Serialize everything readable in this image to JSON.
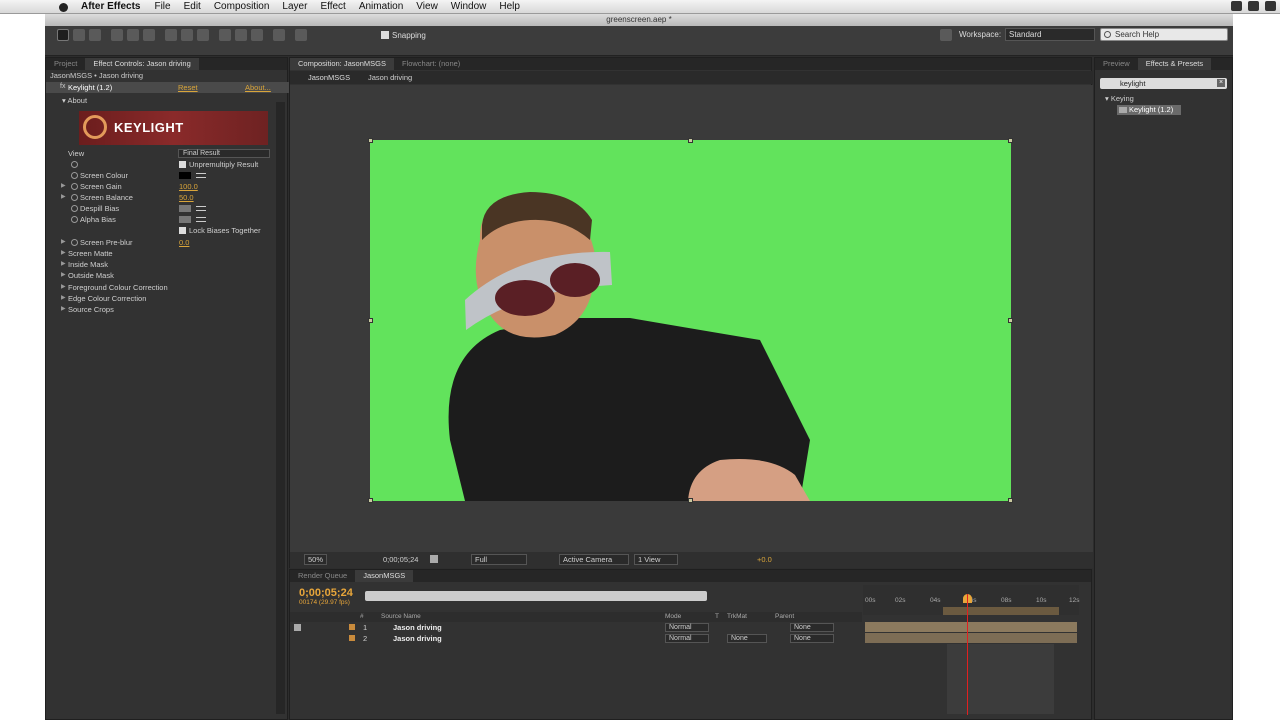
{
  "menubar": {
    "app_name": "After Effects",
    "items": [
      "File",
      "Edit",
      "Composition",
      "Layer",
      "Effect",
      "Animation",
      "View",
      "Window",
      "Help"
    ]
  },
  "window": {
    "title": "greenscreen.aep *"
  },
  "toolbar": {
    "snapping_label": "Snapping",
    "workspace_label": "Workspace:",
    "workspace_value": "Standard",
    "search_placeholder": "Search Help"
  },
  "left_panel": {
    "tabs": [
      "Project",
      "Effect Controls: Jason driving"
    ],
    "title": "JasonMSGS • Jason driving",
    "effect": {
      "name": "Keylight (1.2)",
      "fx": "fx",
      "reset": "Reset",
      "about": "About..."
    },
    "about_label": "About",
    "logo_text": "KEYLIGHT",
    "view_label": "View",
    "view_value": "Final Result",
    "unpremultiply": "Unpremultiply Result",
    "screen_colour": "Screen Colour",
    "screen_gain": "Screen Gain",
    "screen_gain_value": "100.0",
    "screen_balance": "Screen Balance",
    "screen_balance_value": "50.0",
    "despill_bias": "Despill Bias",
    "alpha_bias": "Alpha Bias",
    "lock_biases": "Lock Biases Together",
    "screen_preblur": "Screen Pre-blur",
    "screen_preblur_value": "0.0",
    "groups": [
      "Screen Matte",
      "Inside Mask",
      "Outside Mask",
      "Foreground Colour Correction",
      "Edge Colour Correction",
      "Source Crops"
    ]
  },
  "comp_panel": {
    "tabs": [
      "Composition: JasonMSGS",
      "Flowchart: (none)"
    ],
    "crumbs": [
      "JasonMSGS",
      "Jason driving"
    ],
    "bottom": {
      "zoom": "50%",
      "timecode": "0;00;05;24",
      "resolution": "Full",
      "camera": "Active Camera",
      "views": "1 View",
      "exposure": "+0.0"
    }
  },
  "right_panel": {
    "tabs": [
      "Preview",
      "Effects & Presets"
    ],
    "search_value": "keylight",
    "category": "Keying",
    "item": "Keylight (1.2)"
  },
  "timeline": {
    "tabs": [
      "Render Queue",
      "JasonMSGS"
    ],
    "timecode": "0;00;05;24",
    "fps": "00174 (29.97 fps)",
    "columns": [
      "#",
      "Source Name",
      "Mode",
      "T",
      "TrkMat",
      "Parent"
    ],
    "layers": [
      {
        "num": "1",
        "name": "Jason driving",
        "mode": "Normal",
        "trkmat": "",
        "parent": "None"
      },
      {
        "num": "2",
        "name": "Jason driving",
        "mode": "Normal",
        "trkmat": "None",
        "parent": "None"
      }
    ],
    "ruler": [
      "00s",
      "02s",
      "04s",
      "06s",
      "08s",
      "10s",
      "12s"
    ]
  },
  "colors": {
    "accent": "#d9a53a",
    "green_screen": "#62e35c",
    "playhead": "#e02020"
  }
}
